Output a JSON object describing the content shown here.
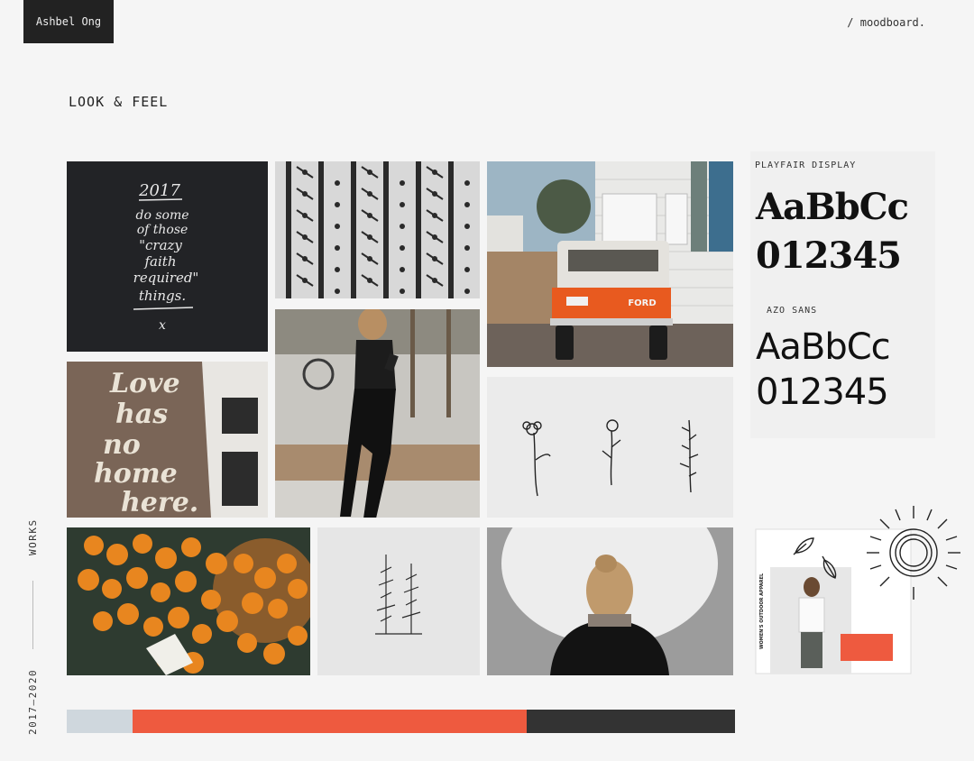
{
  "header": {
    "brand": "Ashbel Ong",
    "nav_link": "/ moodboard."
  },
  "section": {
    "title": "LOOK & FEEL"
  },
  "sidebar": {
    "works_label": "WORKS",
    "years_label": "2017–2020"
  },
  "quote_card": {
    "lines": [
      "2017",
      "do some",
      "of those",
      "\"crazy",
      "faith",
      "required\"",
      "things.",
      "x"
    ]
  },
  "wall_lettering": {
    "lines": [
      "Love",
      "has",
      "no",
      "home",
      "here."
    ]
  },
  "truck": {
    "plate": "FORD"
  },
  "typography": {
    "font1": {
      "name": "PLAYFAIR DISPLAY",
      "sample_letters": "AaBbCc",
      "sample_numbers": "012345"
    },
    "font2": {
      "name": "AZO SANS",
      "sample_letters": "AaBbCc",
      "sample_numbers": "012345"
    }
  },
  "brand_card": {
    "vertical_text": "WOMEN'S OUTDOOR APPAREL"
  },
  "palette": {
    "colors": [
      {
        "name": "light-blue-grey",
        "hex": "#cfd7dd"
      },
      {
        "name": "coral-red",
        "hex": "#ee5a3f"
      },
      {
        "name": "charcoal",
        "hex": "#333333"
      }
    ]
  }
}
